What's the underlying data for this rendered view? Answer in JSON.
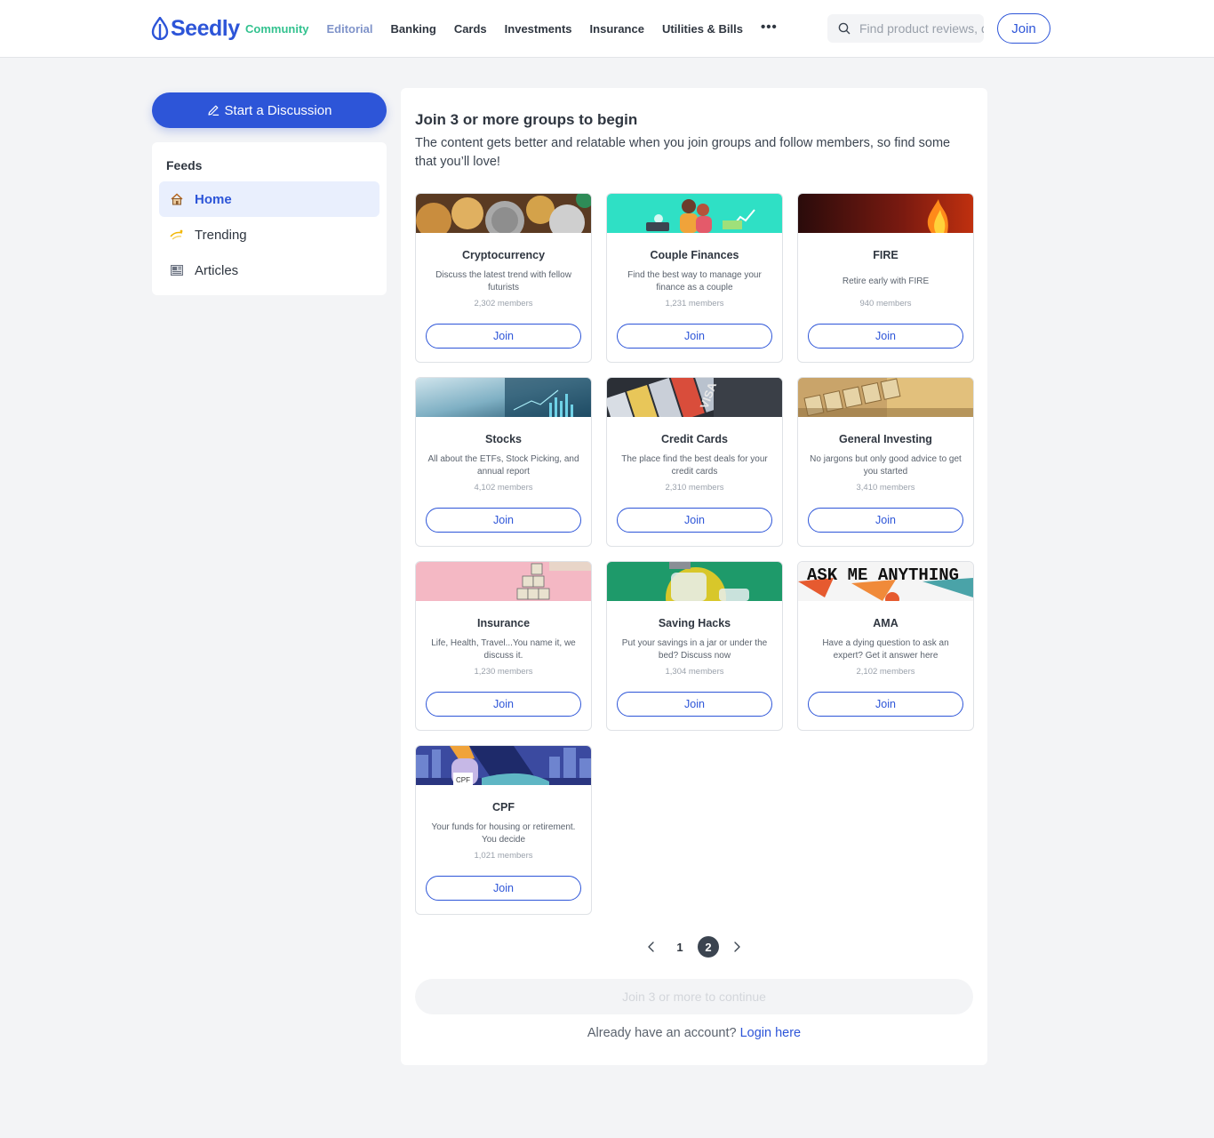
{
  "header": {
    "brand": "Seedly",
    "nav": [
      "Community",
      "Editorial",
      "Banking",
      "Cards",
      "Investments",
      "Insurance",
      "Utilities & Bills"
    ],
    "more": "•••",
    "search_placeholder": "Find product reviews, questions and more",
    "join_label": "Join"
  },
  "sidebar": {
    "start_label": "Start a Discussion",
    "feeds_title": "Feeds",
    "items": [
      {
        "label": "Home",
        "icon": "house-icon",
        "active": true
      },
      {
        "label": "Trending",
        "icon": "sparkle-icon",
        "active": false
      },
      {
        "label": "Articles",
        "icon": "newspaper-icon",
        "active": false
      }
    ]
  },
  "main": {
    "title": "Join 3 or more groups to begin",
    "subtitle": "The content gets better and relatable when you join groups and follow members, so find some that you’ll love!",
    "join_label": "Join",
    "groups": [
      {
        "name": "Cryptocurrency",
        "desc": "Discuss the latest trend with fellow futurists",
        "members": "2,302 members",
        "image": "coins"
      },
      {
        "name": "Couple Finances",
        "desc": "Find the best way to manage your finance as a couple",
        "members": "1,231 members",
        "image": "couple"
      },
      {
        "name": "FIRE",
        "desc": "Retire early with FIRE",
        "members": "940 members",
        "image": "fire"
      },
      {
        "name": "Stocks",
        "desc": "All about the ETFs, Stock Picking, and annual report",
        "members": "4,102 members",
        "image": "stocks"
      },
      {
        "name": "Credit Cards",
        "desc": "The place find the best deals for your credit cards",
        "members": "2,310 members",
        "image": "cards"
      },
      {
        "name": "General Investing",
        "desc": "No jargons but only good advice to get you started",
        "members": "3,410 members",
        "image": "invest"
      },
      {
        "name": "Insurance",
        "desc": "Life, Health, Travel...You name it, we discuss it.",
        "members": "1,230 members",
        "image": "insurance"
      },
      {
        "name": "Saving Hacks",
        "desc": "Put your savings in a jar or under the bed? Discuss now",
        "members": "1,304 members",
        "image": "jars"
      },
      {
        "name": "AMA",
        "desc": "Have a dying question to ask an expert? Get it answer here",
        "members": "2,102 members",
        "image": "ama"
      },
      {
        "name": "CPF",
        "desc": "Your funds for housing or retirement. You decide",
        "members": "1,021 members",
        "image": "cpf"
      }
    ],
    "pagination": {
      "pages": [
        "1",
        "2"
      ],
      "current": "2"
    },
    "continue_label": "Join 3 or more to continue",
    "login_prompt": "Already have an account?",
    "login_link": "Login here"
  },
  "images_text": {
    "ama_banner": "ASK ME ANYTHING",
    "cpf_tag": "CPF",
    "cards_visa": "VISA"
  },
  "colors": {
    "brand": "#2d55d8",
    "community": "#33c28f",
    "editorial": "#7f93c9"
  }
}
